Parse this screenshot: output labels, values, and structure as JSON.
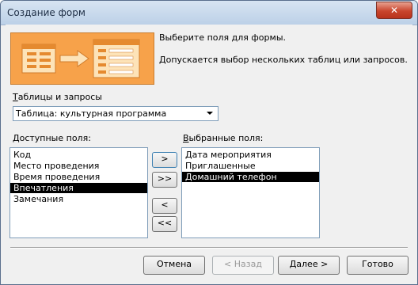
{
  "window": {
    "title": "Создание форм",
    "close_label": "✕"
  },
  "header": {
    "prompt": "Выберите поля для формы.",
    "hint": "Допускается выбор нескольких таблиц или запросов."
  },
  "source": {
    "label_u": "Т",
    "label_rest": "аблицы и запросы",
    "selected": "Таблица: культурная программа"
  },
  "available": {
    "label_u": "Д",
    "label_rest": "оступные поля:",
    "items": [
      "Код",
      "Место проведения",
      "Время проведения",
      "Впечатления",
      "Замечания"
    ],
    "selected_index": 3
  },
  "chosen": {
    "label_u": "В",
    "label_rest": "ыбранные поля:",
    "items": [
      "Дата мероприятия",
      "Приглашенные",
      "Домашний телефон"
    ],
    "selected_index": 2
  },
  "move_buttons": {
    "add": ">",
    "add_all": ">>",
    "remove": "<",
    "remove_all": "<<"
  },
  "buttons": {
    "cancel": "Отмена",
    "back": "< Назад",
    "next": "Далее >",
    "finish": "Готово"
  }
}
